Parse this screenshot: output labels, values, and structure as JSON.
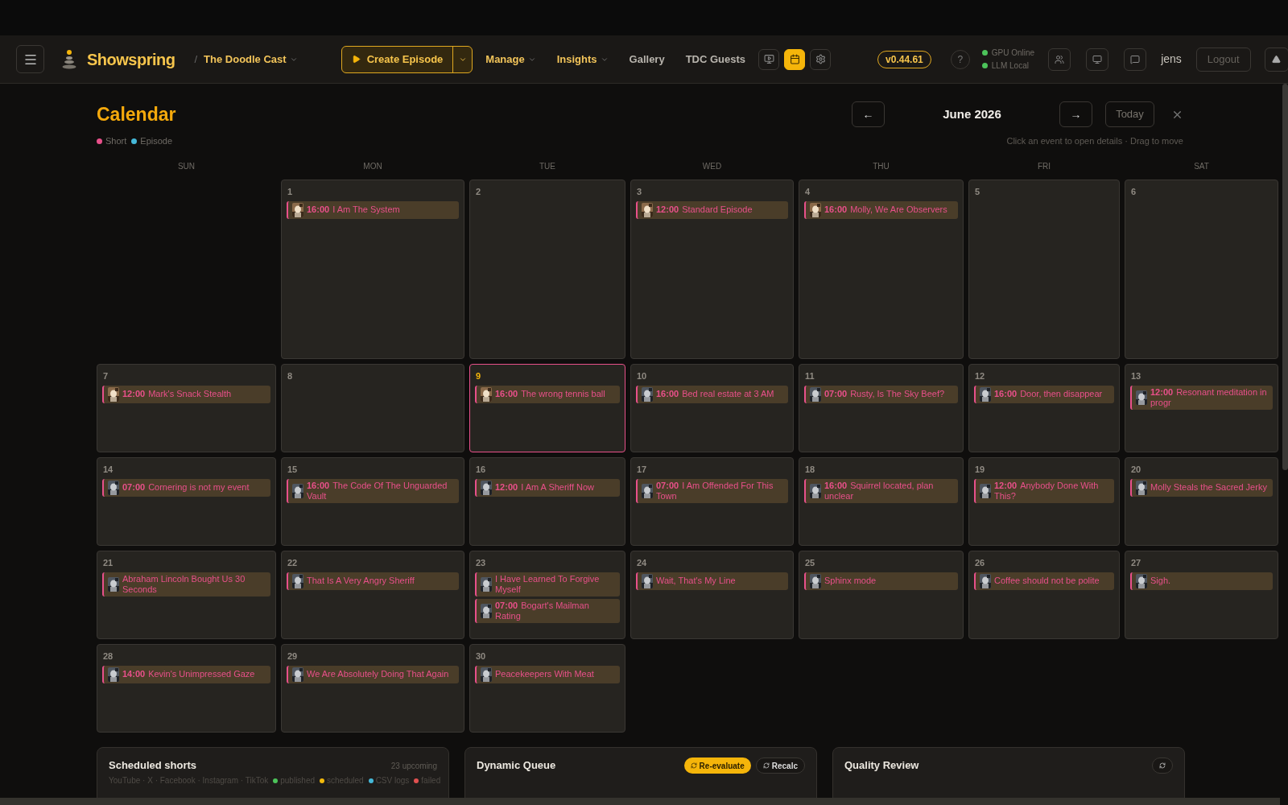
{
  "header": {
    "brand": "Showspring",
    "separator": "/",
    "show": "The Doodle Cast",
    "create_button": "Create Episode",
    "nav": [
      {
        "label": "Manage",
        "dropdown": true
      },
      {
        "label": "Insights",
        "dropdown": true
      },
      {
        "label": "Gallery",
        "dropdown": false
      },
      {
        "label": "TDC Guests",
        "dropdown": false
      }
    ],
    "view_buttons": [
      {
        "kind": "video",
        "selected": false
      },
      {
        "kind": "calendar",
        "selected": true
      },
      {
        "kind": "gear",
        "selected": false
      }
    ],
    "version": "v0.44.61",
    "help": "?",
    "status": [
      {
        "label": "GPU Online",
        "color": "#4cc35a"
      },
      {
        "label": "LLM Local",
        "color": "#4cc35a"
      }
    ],
    "tool_buttons": [
      {
        "kind": "users"
      },
      {
        "kind": "monitor"
      },
      {
        "kind": "chat"
      }
    ],
    "user": "jens",
    "logout": "Logout"
  },
  "calendar": {
    "title": "Calendar",
    "prev": "←",
    "month": "June 2026",
    "next": "→",
    "today": "Today",
    "legend": [
      {
        "label": "Short",
        "color": "#e8508a"
      },
      {
        "label": "Episode",
        "color": "#45b8d8"
      }
    ],
    "hint": "Click an event to open details · Drag to move",
    "weekdays": [
      "SUN",
      "MON",
      "TUE",
      "WED",
      "THU",
      "FRI",
      "SAT"
    ],
    "weeks": [
      {
        "days": [
          {
            "number": "1",
            "today": false,
            "events": [
              {
                "time": "16:00",
                "title": "I Am The System",
                "color": "#e8508a"
              }
            ]
          },
          {
            "number": "2",
            "today": false
          },
          {
            "number": "3",
            "today": false,
            "events": [
              {
                "time": "12:00",
                "title": "Standard Episode",
                "color": "#e8508a"
              }
            ]
          },
          {
            "number": "4",
            "today": false,
            "events": [
              {
                "time": "16:00",
                "title": "Molly, We Are Observers",
                "color": "#e8508a"
              }
            ]
          },
          {
            "number": "5",
            "today": false
          },
          {
            "number": "6",
            "today": false
          }
        ]
      },
      {
        "days": [
          {
            "number": "7",
            "today": false,
            "events": [
              {
                "time": "12:00",
                "title": "Mark's Snack Stealth",
                "color": "#e8508a"
              }
            ]
          },
          {
            "number": "8",
            "today": false
          },
          {
            "number": "9",
            "today": true,
            "events": [
              {
                "time": "16:00",
                "title": "The wrong tennis ball",
                "color": "#e8508a"
              }
            ]
          },
          {
            "number": "10",
            "today": false,
            "events": [
              {
                "time": "16:00",
                "title": "Bed real estate at 3 AM",
                "color": "#e8508a"
              }
            ]
          },
          {
            "number": "11",
            "today": false,
            "events": [
              {
                "time": "07:00",
                "title": "Rusty, Is The Sky Beef?",
                "color": "#e8508a"
              }
            ]
          },
          {
            "number": "12",
            "today": false,
            "events": [
              {
                "time": "16:00",
                "title": "Door, then disappear",
                "color": "#e8508a"
              }
            ]
          },
          {
            "number": "13",
            "today": false,
            "events": [
              {
                "time": "12:00",
                "title": "Resonant meditation in progr",
                "color": "#e8508a"
              }
            ]
          }
        ]
      },
      {
        "days": [
          {
            "number": "14",
            "today": false,
            "events": [
              {
                "time": "07:00",
                "title": "Cornering is not my event",
                "color": "#e8508a"
              }
            ]
          },
          {
            "number": "15",
            "today": false,
            "events": [
              {
                "time": "16:00",
                "title": "The Code Of The Unguarded Vault",
                "color": "#e8508a"
              }
            ]
          },
          {
            "number": "16",
            "today": false,
            "events": [
              {
                "time": "12:00",
                "title": "I Am A Sheriff Now",
                "color": "#e8508a"
              }
            ]
          },
          {
            "number": "17",
            "today": false,
            "events": [
              {
                "time": "07:00",
                "title": "I Am Offended For This Town",
                "color": "#e8508a"
              }
            ]
          },
          {
            "number": "18",
            "today": false,
            "events": [
              {
                "time": "16:00",
                "title": "Squirrel located, plan unclear",
                "color": "#e8508a"
              }
            ]
          },
          {
            "number": "19",
            "today": false,
            "events": [
              {
                "time": "12:00",
                "title": "Anybody Done With This?",
                "color": "#e8508a"
              }
            ]
          },
          {
            "number": "20",
            "today": false,
            "events": [
              {
                "title": "Molly Steals the Sacred Jerky",
                "color": "#e8508a"
              }
            ]
          }
        ]
      },
      {
        "days": [
          {
            "number": "21",
            "today": false,
            "events": [
              {
                "title": "Abraham Lincoln Bought Us 30 Seconds",
                "color": "#e8508a"
              }
            ]
          },
          {
            "number": "22",
            "today": false,
            "events": [
              {
                "title": "That Is A Very Angry Sheriff",
                "color": "#e8508a"
              }
            ]
          },
          {
            "number": "23",
            "today": false,
            "events": [
              {
                "title": "I Have Learned To Forgive Myself",
                "color": "#e8508a"
              },
              {
                "time": "07:00",
                "title": "Bogart's Mailman Rating",
                "color": "#e8508a"
              }
            ]
          },
          {
            "number": "24",
            "today": false,
            "events": [
              {
                "title": "Wait, That's My Line",
                "color": "#e8508a"
              }
            ]
          },
          {
            "number": "25",
            "today": false,
            "events": [
              {
                "title": "Sphinx mode",
                "color": "#e8508a"
              }
            ]
          },
          {
            "number": "26",
            "today": false,
            "events": [
              {
                "title": "Coffee should not be polite",
                "color": "#e8508a"
              }
            ]
          },
          {
            "number": "27",
            "today": false,
            "events": [
              {
                "title": "Sigh.",
                "color": "#e8508a"
              }
            ]
          }
        ]
      },
      {
        "days": [
          {
            "number": "28",
            "today": false,
            "events": [
              {
                "time": "14:00",
                "title": "Kevin's Unimpressed Gaze",
                "color": "#e8508a"
              }
            ]
          },
          {
            "number": "29",
            "today": false,
            "events": [
              {
                "title": "We Are Absolutely Doing That Again",
                "color": "#e8508a"
              }
            ]
          },
          {
            "number": "30",
            "today": false,
            "events": [
              {
                "title": "Peacekeepers With Meat",
                "color": "#e8508a"
              }
            ]
          }
        ]
      }
    ]
  },
  "panels": [
    {
      "title": "Scheduled shorts",
      "count": "23 upcoming",
      "platforms": "YouTube · X · Facebook · Instagram · TikTok",
      "statuses": [
        {
          "label": "published",
          "color": "#4cc35a"
        },
        {
          "label": "scheduled",
          "color": "#f2b90c"
        },
        {
          "label": "CSV logs",
          "color": "#45b8d8"
        },
        {
          "label": "failed",
          "color": "#e05050"
        }
      ]
    },
    {
      "title": "Dynamic Queue",
      "actions": [
        {
          "label": "Re-evaluate",
          "primary": true
        },
        {
          "label": "Recalc",
          "primary": false
        }
      ]
    },
    {
      "title": "Quality Review",
      "actions": [
        {
          "primary": false
        }
      ]
    }
  ]
}
